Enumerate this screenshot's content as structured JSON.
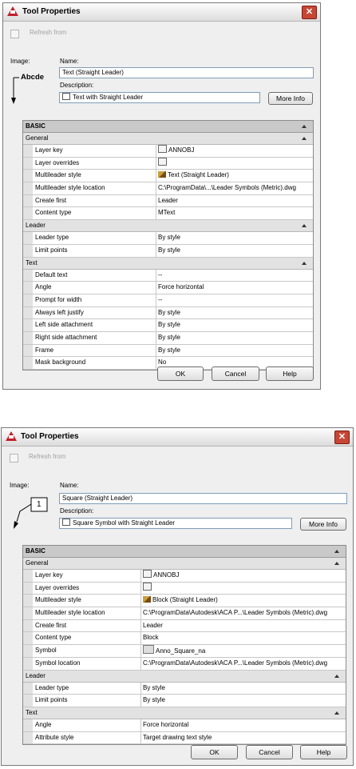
{
  "colors": {
    "close": "#c64635",
    "icon": "#c0202a",
    "grid_header": "#c9c9c9",
    "category": "#e2e2e2"
  },
  "dialog1": {
    "title": "Tool Properties",
    "close_glyph": "✕",
    "refresh_from": "Refresh from",
    "image_label": "Image:",
    "name_label": "Name:",
    "name_value": "Text (Straight Leader)",
    "description_label": "Description:",
    "description_value": "Text with Straight Leader",
    "more_info": "More Info",
    "preview_text": "Abcde",
    "basic": "BASIC",
    "categories": [
      {
        "name": "General",
        "rows": [
          {
            "label": "Layer key",
            "value": "ANNOBJ",
            "icon": "layer-icon"
          },
          {
            "label": "Layer overrides",
            "value": "",
            "icon": "layer-icon"
          },
          {
            "label": "Multileader style",
            "value": "Text (Straight Leader)",
            "icon": "pen-icon"
          },
          {
            "label": "Multileader style location",
            "value": "C:\\ProgramData\\...\\Leader Symbols (Metric).dwg",
            "icon": ""
          },
          {
            "label": "Create first",
            "value": "Leader",
            "icon": ""
          },
          {
            "label": "Content type",
            "value": "MText",
            "icon": ""
          }
        ]
      },
      {
        "name": "Leader",
        "rows": [
          {
            "label": "Leader type",
            "value": "By style",
            "icon": ""
          },
          {
            "label": "Limit points",
            "value": "By style",
            "icon": ""
          }
        ]
      },
      {
        "name": "Text",
        "rows": [
          {
            "label": "Default text",
            "value": "--",
            "icon": ""
          },
          {
            "label": "Angle",
            "value": "Force horizontal",
            "icon": ""
          },
          {
            "label": "Prompt for width",
            "value": "--",
            "icon": ""
          },
          {
            "label": "Always left justify",
            "value": "By style",
            "icon": ""
          },
          {
            "label": "Left side attachment",
            "value": "By style",
            "icon": ""
          },
          {
            "label": "Right side attachment",
            "value": "By style",
            "icon": ""
          },
          {
            "label": "Frame",
            "value": "By style",
            "icon": ""
          },
          {
            "label": "Mask background",
            "value": "No",
            "icon": ""
          }
        ]
      }
    ],
    "ok": "OK",
    "cancel": "Cancel",
    "help": "Help"
  },
  "dialog2": {
    "title": "Tool Properties",
    "close_glyph": "✕",
    "refresh_from": "Refresh from",
    "image_label": "Image:",
    "name_label": "Name:",
    "name_value": "Square (Straight Leader)",
    "description_label": "Description:",
    "description_value": "Square Symbol with Straight Leader",
    "more_info": "More Info",
    "preview_text": "1",
    "basic": "BASIC",
    "categories": [
      {
        "name": "General",
        "rows": [
          {
            "label": "Layer key",
            "value": "ANNOBJ",
            "icon": "layer-icon"
          },
          {
            "label": "Layer overrides",
            "value": "",
            "icon": "layer-icon"
          },
          {
            "label": "Multileader style",
            "value": "Block (Straight Leader)",
            "icon": "pen-icon"
          },
          {
            "label": "Multileader style location",
            "value": "C:\\ProgramData\\Autodesk\\ACA P...\\Leader Symbols (Metric).dwg",
            "icon": ""
          },
          {
            "label": "Create first",
            "value": "Leader",
            "icon": ""
          },
          {
            "label": "Content type",
            "value": "Block",
            "icon": ""
          },
          {
            "label": "Symbol",
            "value": "Anno_Square_na",
            "icon": "block-icon"
          },
          {
            "label": "Symbol location",
            "value": "C:\\ProgramData\\Autodesk\\ACA P...\\Leader Symbols (Metric).dwg",
            "icon": ""
          }
        ]
      },
      {
        "name": "Leader",
        "rows": [
          {
            "label": "Leader type",
            "value": "By style",
            "icon": ""
          },
          {
            "label": "Limit points",
            "value": "By style",
            "icon": ""
          }
        ]
      },
      {
        "name": "Text",
        "rows": [
          {
            "label": "Angle",
            "value": "Force horizontal",
            "icon": ""
          },
          {
            "label": "Attribute style",
            "value": "Target drawing text style",
            "icon": ""
          }
        ]
      }
    ],
    "ok": "OK",
    "cancel": "Cancel",
    "help": "Help"
  }
}
